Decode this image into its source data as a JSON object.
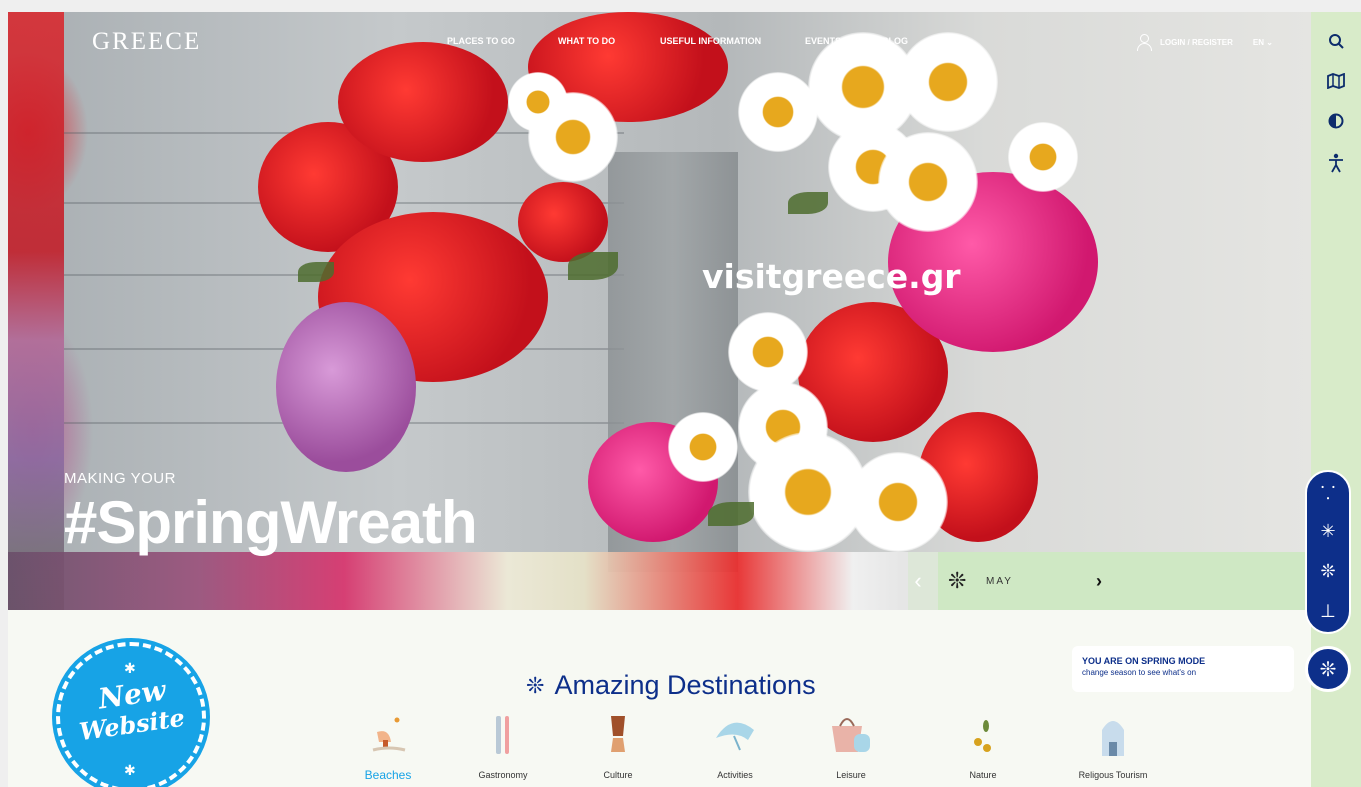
{
  "header": {
    "logo": "GREECE",
    "nav": [
      "PLACES TO GO",
      "WHAT TO DO",
      "USEFUL INFORMATION",
      "EVENTS",
      "BLOG"
    ],
    "login_label": "LOGIN / REGISTER",
    "language": "EN"
  },
  "hero": {
    "watermark": "visitgreece.gr",
    "tagline": "MAKING YOUR",
    "headline": "#SpringWreath",
    "month": "MAY"
  },
  "rail": {
    "icons": [
      "search-icon",
      "map-icon",
      "contrast-icon",
      "accessibility-icon"
    ],
    "season_icons": [
      "summer-icon",
      "winter-icon",
      "spring-icon",
      "autumn-icon"
    ]
  },
  "spring_note": {
    "title": "YOU ARE ON SPRING MODE",
    "subtitle": "change season to see what's on"
  },
  "badge": {
    "line1": "New",
    "line2": "Website"
  },
  "destinations": {
    "title": "Amazing Destinations",
    "categories": [
      "Beaches",
      "Gastronomy",
      "Culture",
      "Activities",
      "Leisure",
      "Nature",
      "Religous Tourism"
    ]
  },
  "colors": {
    "accent": "#0d2f8a",
    "active_category": "#17a3e6",
    "rail_bg": "#d8ebc9"
  }
}
